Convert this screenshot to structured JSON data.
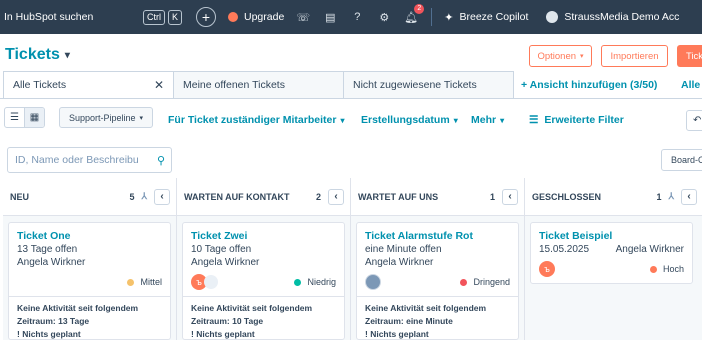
{
  "topnav": {
    "search_label": "In HubSpot suchen",
    "kbd1": "Ctrl",
    "kbd2": "K",
    "plus": "+",
    "upgrade_label": "Upgrade",
    "notification_count": "2",
    "copilot_label": "Breeze Copilot",
    "account_label": "StraussMedia Demo Acc"
  },
  "header": {
    "title": "Tickets",
    "actions_label": "Optionen",
    "import_label": "Importieren",
    "create_label": "Tick"
  },
  "tabs": [
    {
      "label": "Alle Tickets"
    },
    {
      "label": "Meine offenen Tickets"
    },
    {
      "label": "Nicht zugewiesene Tickets"
    }
  ],
  "add_view_label": "+ Ansicht hinzufügen (3/50)",
  "all_views_label": "Alle",
  "filters": {
    "pipeline": "Support-Pipeline",
    "owner": "Für Ticket zuständiger Mitarbeiter",
    "created": "Erstellungsdatum",
    "more": "Mehr",
    "advanced": "Erweiterte Filter"
  },
  "search": {
    "placeholder": "ID, Name oder Beschreibu"
  },
  "board_button": "Board-O",
  "columns": [
    {
      "name": "NEU",
      "count": "5",
      "cards": [
        {
          "title": "Ticket One",
          "line1": "13 Tage offen",
          "owner": "Angela Wirkner",
          "priority": "Mittel",
          "priority_color": "#f5c26b",
          "activity1": "Keine Aktivität seit folgendem",
          "activity2": "Zeitraum: 13 Tage",
          "activity3": "! Nichts geplant"
        }
      ]
    },
    {
      "name": "WARTEN AUF KONTAKT",
      "count": "2",
      "cards": [
        {
          "title": "Ticket Zwei",
          "line1": "10 Tage offen",
          "owner": "Angela Wirkner",
          "priority": "Niedrig",
          "priority_color": "#00bda5",
          "activity1": "Keine Aktivität seit folgendem",
          "activity2": "Zeitraum: 10 Tage",
          "activity3": "! Nichts geplant"
        }
      ]
    },
    {
      "name": "WARTET AUF UNS",
      "count": "1",
      "cards": [
        {
          "title": "Ticket Alarmstufe Rot",
          "line1": "eine Minute offen",
          "owner": "Angela Wirkner",
          "priority": "Dringend",
          "priority_color": "#f2545b",
          "activity1": "Keine Aktivität seit folgendem",
          "activity2": "Zeitraum: eine Minute",
          "activity3": "! Nichts geplant"
        }
      ]
    },
    {
      "name": "GESCHLOSSEN",
      "count": "1",
      "cards": [
        {
          "title": "Ticket Beispiel",
          "line1": "15.05.2025",
          "owner": "Angela Wirkner",
          "priority": "Hoch",
          "priority_color": "#ff7a59"
        }
      ]
    }
  ]
}
